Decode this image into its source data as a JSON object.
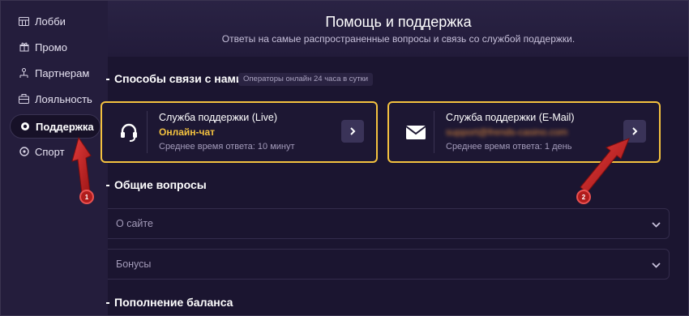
{
  "sidebar": {
    "items": [
      {
        "label": "Лобби",
        "icon": "grid-icon"
      },
      {
        "label": "Промо",
        "icon": "gift-icon"
      },
      {
        "label": "Партнерам",
        "icon": "people-icon"
      },
      {
        "label": "Лояльность",
        "icon": "briefcase-icon"
      },
      {
        "label": "Поддержка",
        "icon": "lifebuoy-icon",
        "active": true
      },
      {
        "label": "Спорт",
        "icon": "ball-icon"
      }
    ]
  },
  "header": {
    "title": "Помощь и поддержка",
    "subtitle": "Ответы на самые распространенные вопросы и связь со службой поддержки."
  },
  "contact": {
    "title": "Способы связи с нами",
    "badge": "Операторы онлайн 24 часа в сутки",
    "live": {
      "title": "Служба поддержки (Live)",
      "subtitle": "Онлайн-чат",
      "meta": "Среднее время ответа: 10 минут"
    },
    "email": {
      "title": "Служба поддержки (E-Mail)",
      "subtitle": "support@frends-casino.com",
      "meta": "Среднее время ответа: 1 день"
    }
  },
  "faq": {
    "title": "Общие вопросы",
    "items": [
      "О сайте",
      "Бонусы"
    ]
  },
  "deposit": {
    "title": "Пополнение баланса"
  },
  "annotations": {
    "marker1": "1",
    "marker2": "2"
  },
  "colors": {
    "accent": "#f4c23f",
    "background": "#1b1530",
    "sidebar": "#241d3c",
    "marker": "#b01c1c"
  }
}
